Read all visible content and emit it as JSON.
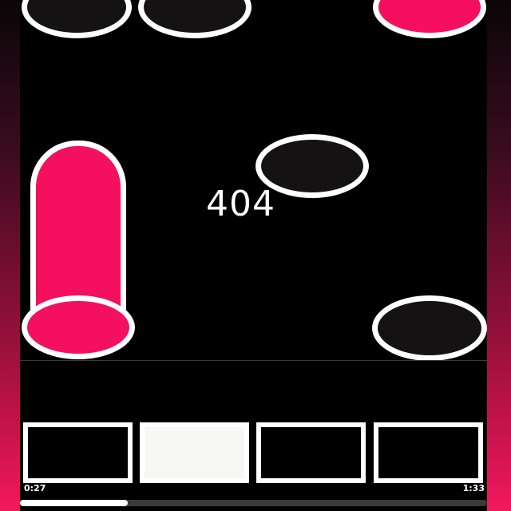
{
  "score": "404",
  "playback": {
    "elapsed": "0:27",
    "total": "1:33",
    "progress_fraction": 0.23
  },
  "lanes": [
    {
      "lane": 1,
      "pad_pressed": false
    },
    {
      "lane": 2,
      "pad_pressed": true
    },
    {
      "lane": 3,
      "pad_pressed": false
    },
    {
      "lane": 4,
      "pad_pressed": false
    }
  ],
  "colors": {
    "accent_pink": "#f4105f",
    "note_dark": "#141213",
    "outline": "#ffffff",
    "background": "#000000"
  },
  "icons": {
    "note": "circle-note",
    "hold_note": "capsule-hold-note"
  }
}
